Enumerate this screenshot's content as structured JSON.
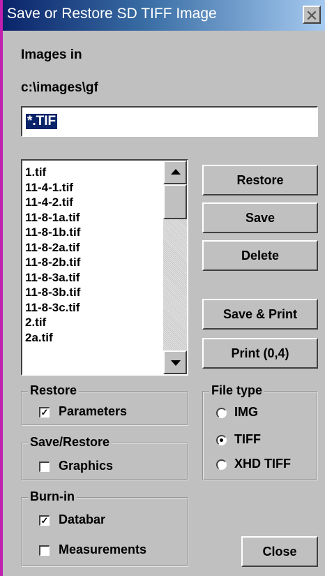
{
  "window": {
    "title": "Save or Restore SD TIFF Image",
    "close_glyph": "✕"
  },
  "images_in_label": "Images in",
  "directory": "c:\\images\\gf",
  "filter": {
    "value": "*.TIF"
  },
  "file_list": {
    "items": [
      "1.tif",
      "11-4-1.tif",
      "11-4-2.tif",
      "11-8-1a.tif",
      "11-8-1b.tif",
      "11-8-2a.tif",
      "11-8-2b.tif",
      "11-8-3a.tif",
      "11-8-3b.tif",
      "11-8-3c.tif",
      "2.tif",
      "2a.tif"
    ]
  },
  "buttons": {
    "restore": "Restore",
    "save": "Save",
    "delete": "Delete",
    "save_print": "Save & Print",
    "print": "Print (0,4)",
    "close": "Close"
  },
  "groups": {
    "restore": {
      "legend": "Restore",
      "parameters": {
        "label": "Parameters",
        "checked": true
      }
    },
    "save_restore": {
      "legend": "Save/Restore",
      "graphics": {
        "label": "Graphics",
        "checked": false
      }
    },
    "burn_in": {
      "legend": "Burn-in",
      "databar": {
        "label": "Databar",
        "checked": true
      },
      "measurements": {
        "label": "Measurements",
        "checked": false
      }
    },
    "file_type": {
      "legend": "File type",
      "options": [
        {
          "label": "IMG",
          "selected": false
        },
        {
          "label": "TIFF",
          "selected": true
        },
        {
          "label": "XHD TIFF",
          "selected": false
        }
      ]
    }
  },
  "colors": {
    "title_start": "#0a246a",
    "title_end": "#a6caf0",
    "face": "#c0c0c0",
    "selection": "#0a246a"
  }
}
